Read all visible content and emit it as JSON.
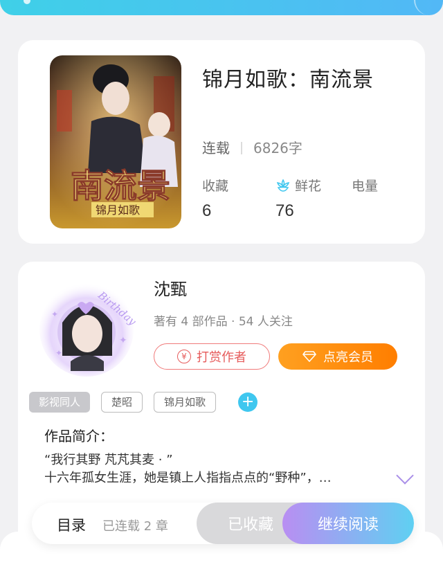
{
  "book": {
    "title": "锦月如歌：南流景",
    "cover_title_big": "南流景",
    "cover_title_small": "锦月如歌",
    "status": "连载",
    "word_count": "6826字",
    "stats": {
      "collect_label": "收藏",
      "collect_value": "6",
      "flower_label": "鲜花",
      "flower_value": "76",
      "power_label": "电量",
      "power_value": ""
    }
  },
  "author": {
    "name": "沈甄",
    "stats": "著有 4 部作品 · 54 人关注",
    "reward_label": "打赏作者",
    "vip_label": "点亮会员",
    "avatar_text": "Birthday"
  },
  "tags": [
    "影视同人",
    "楚昭",
    "锦月如歌"
  ],
  "tag_add": "+",
  "intro": {
    "title": "作品简介：",
    "line1": "“我行其野 芃芃其麦 · ”",
    "line2": "十六年孤女生涯，她是镇上人指指点点的“野种”，…"
  },
  "bottom": {
    "toc_label": "目录",
    "chapters_label": "已连载 2 章",
    "collected_label": "已收藏",
    "read_label": "继续阅读"
  },
  "colors": {
    "accent_cyan": "#3fc7ef",
    "vip_orange": "#ff8c10",
    "reward_red": "#e65a5a",
    "read_gradient_start": "#b98ef2",
    "read_gradient_end": "#5fd0f2"
  }
}
